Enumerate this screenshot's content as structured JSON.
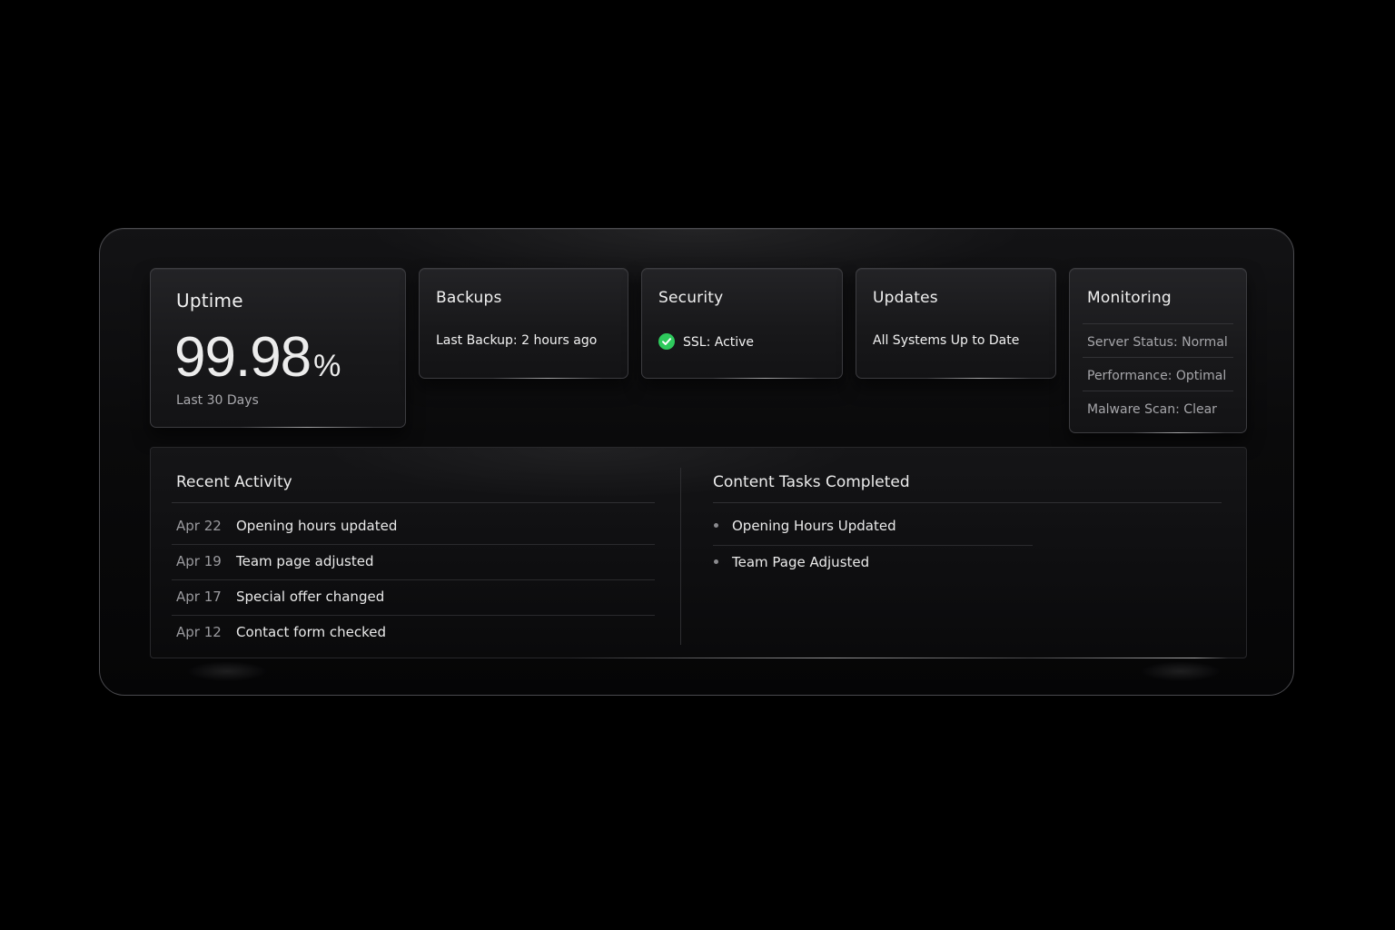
{
  "uptime": {
    "title": "Uptime",
    "value": "99.98",
    "unit": "%",
    "period": "Last 30 Days"
  },
  "backups": {
    "title": "Backups",
    "line": "Last Backup: 2 hours ago"
  },
  "security": {
    "title": "Security",
    "line": "SSL: Active",
    "status_icon": "check-circle-icon",
    "status_color": "#2ec95c"
  },
  "updates": {
    "title": "Updates",
    "line": "All Systems Up to Date"
  },
  "monitoring": {
    "title": "Monitoring",
    "items": [
      "Server Status: Normal",
      "Performance: Optimal",
      "Malware Scan: Clear"
    ]
  },
  "recent_activity": {
    "title": "Recent Activity",
    "items": [
      {
        "date": "Apr 22",
        "text": "Opening hours updated"
      },
      {
        "date": "Apr 19",
        "text": "Team page adjusted"
      },
      {
        "date": "Apr 17",
        "text": "Special offer changed"
      },
      {
        "date": "Apr 12",
        "text": "Contact form checked"
      }
    ]
  },
  "content_tasks": {
    "title": "Content Tasks Completed",
    "items": [
      "Opening Hours Updated",
      "Team Page Adjusted"
    ]
  }
}
